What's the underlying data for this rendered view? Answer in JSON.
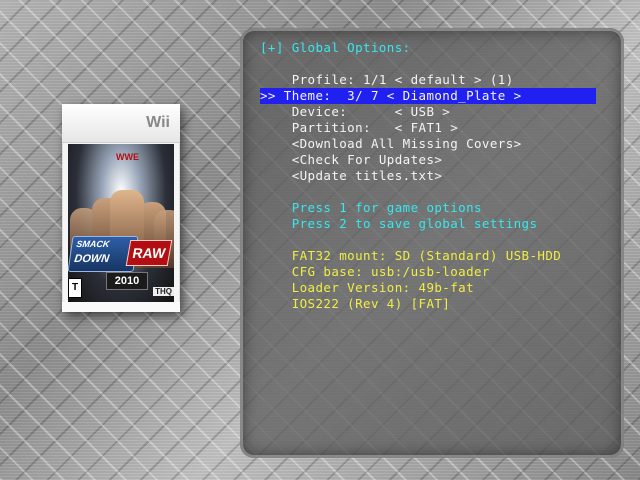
{
  "cover": {
    "platform": "Wii",
    "game_logo_line1": "SMACK",
    "game_logo_line2": "DOWN",
    "raw_logo": "RAW",
    "year": "2010",
    "brand": "WWE",
    "rating": "T",
    "publisher": "THQ"
  },
  "options": {
    "header": "[+] Global Options:",
    "items": [
      "    Profile: 1/1 < default > (1)",
      ">> Theme:  3/ 7 < Diamond_Plate >",
      "    Device:      < USB >",
      "    Partition:   < FAT1 >",
      "    <Download All Missing Covers>",
      "    <Check For Updates>",
      "    <Update titles.txt>"
    ],
    "hints": [
      "    Press 1 for game options",
      "    Press 2 to save global settings"
    ],
    "info": [
      "    FAT32 mount: SD (Standard) USB-HDD",
      "    CFG base: usb:/usb-loader",
      "    Loader Version: 49b-fat",
      "    IOS222 (Rev 4) [FAT]"
    ]
  },
  "colors": {
    "selection": "#2020f0",
    "header": "#35e8ee",
    "hints": "#35e8ee",
    "info": "#f0ee43",
    "menu": "#f4f4f4"
  }
}
